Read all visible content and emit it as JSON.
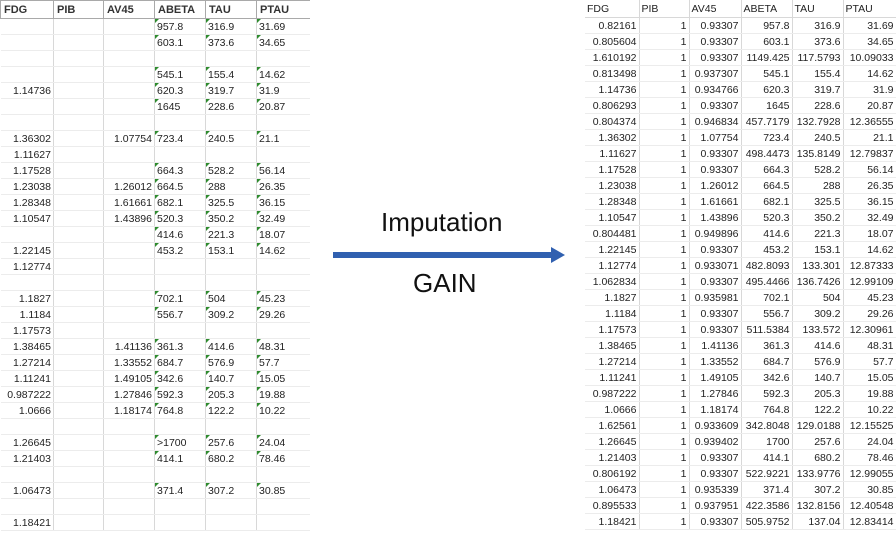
{
  "headers": [
    "FDG",
    "PIB",
    "AV45",
    "ABETA",
    "TAU",
    "PTAU"
  ],
  "left_rows": [
    [
      "",
      "",
      "",
      "957.8",
      "316.9",
      "31.69"
    ],
    [
      "",
      "",
      "",
      "603.1",
      "373.6",
      "34.65"
    ],
    [
      "",
      "",
      "",
      "",
      "",
      ""
    ],
    [
      "",
      "",
      "",
      "545.1",
      "155.4",
      "14.62"
    ],
    [
      "1.14736",
      "",
      "",
      "620.3",
      "319.7",
      "31.9"
    ],
    [
      "",
      "",
      "",
      "1645",
      "228.6",
      "20.87"
    ],
    [
      "",
      "",
      "",
      "",
      "",
      ""
    ],
    [
      "1.36302",
      "",
      "1.07754",
      "723.4",
      "240.5",
      "21.1"
    ],
    [
      "1.11627",
      "",
      "",
      "",
      "",
      ""
    ],
    [
      "1.17528",
      "",
      "",
      "664.3",
      "528.2",
      "56.14"
    ],
    [
      "1.23038",
      "",
      "1.26012",
      "664.5",
      "288",
      "26.35"
    ],
    [
      "1.28348",
      "",
      "1.61661",
      "682.1",
      "325.5",
      "36.15"
    ],
    [
      "1.10547",
      "",
      "1.43896",
      "520.3",
      "350.2",
      "32.49"
    ],
    [
      "",
      "",
      "",
      "414.6",
      "221.3",
      "18.07"
    ],
    [
      "1.22145",
      "",
      "",
      "453.2",
      "153.1",
      "14.62"
    ],
    [
      "1.12774",
      "",
      "",
      "",
      "",
      ""
    ],
    [
      "",
      "",
      "",
      "",
      "",
      ""
    ],
    [
      "1.1827",
      "",
      "",
      "702.1",
      "504",
      "45.23"
    ],
    [
      "1.1184",
      "",
      "",
      "556.7",
      "309.2",
      "29.26"
    ],
    [
      "1.17573",
      "",
      "",
      "",
      "",
      ""
    ],
    [
      "1.38465",
      "",
      "1.41136",
      "361.3",
      "414.6",
      "48.31"
    ],
    [
      "1.27214",
      "",
      "1.33552",
      "684.7",
      "576.9",
      "57.7"
    ],
    [
      "1.11241",
      "",
      "1.49105",
      "342.6",
      "140.7",
      "15.05"
    ],
    [
      "0.987222",
      "",
      "1.27846",
      "592.3",
      "205.3",
      "19.88"
    ],
    [
      "1.0666",
      "",
      "1.18174",
      "764.8",
      "122.2",
      "10.22"
    ],
    [
      "",
      "",
      "",
      "",
      "",
      ""
    ],
    [
      "1.26645",
      "",
      "",
      ">1700",
      "257.6",
      "24.04"
    ],
    [
      "1.21403",
      "",
      "",
      "414.1",
      "680.2",
      "78.46"
    ],
    [
      "",
      "",
      "",
      "",
      "",
      ""
    ],
    [
      "1.06473",
      "",
      "",
      "371.4",
      "307.2",
      "30.85"
    ],
    [
      "",
      "",
      "",
      "",
      "",
      ""
    ],
    [
      "1.18421",
      "",
      "",
      "",
      "",
      ""
    ]
  ],
  "right_rows": [
    [
      "0.82161",
      "1",
      "0.93307",
      "957.8",
      "316.9",
      "31.69"
    ],
    [
      "0.805604",
      "1",
      "0.93307",
      "603.1",
      "373.6",
      "34.65"
    ],
    [
      "1.610192",
      "1",
      "0.93307",
      "1149.425",
      "117.5793",
      "10.09033"
    ],
    [
      "0.813498",
      "1",
      "0.937307",
      "545.1",
      "155.4",
      "14.62"
    ],
    [
      "1.14736",
      "1",
      "0.934766",
      "620.3",
      "319.7",
      "31.9"
    ],
    [
      "0.806293",
      "1",
      "0.93307",
      "1645",
      "228.6",
      "20.87"
    ],
    [
      "0.804374",
      "1",
      "0.946834",
      "457.7179",
      "132.7928",
      "12.36555"
    ],
    [
      "1.36302",
      "1",
      "1.07754",
      "723.4",
      "240.5",
      "21.1"
    ],
    [
      "1.11627",
      "1",
      "0.93307",
      "498.4473",
      "135.8149",
      "12.79837"
    ],
    [
      "1.17528",
      "1",
      "0.93307",
      "664.3",
      "528.2",
      "56.14"
    ],
    [
      "1.23038",
      "1",
      "1.26012",
      "664.5",
      "288",
      "26.35"
    ],
    [
      "1.28348",
      "1",
      "1.61661",
      "682.1",
      "325.5",
      "36.15"
    ],
    [
      "1.10547",
      "1",
      "1.43896",
      "520.3",
      "350.2",
      "32.49"
    ],
    [
      "0.804481",
      "1",
      "0.949896",
      "414.6",
      "221.3",
      "18.07"
    ],
    [
      "1.22145",
      "1",
      "0.93307",
      "453.2",
      "153.1",
      "14.62"
    ],
    [
      "1.12774",
      "1",
      "0.933071",
      "482.8093",
      "133.301",
      "12.87333"
    ],
    [
      "1.062834",
      "1",
      "0.93307",
      "495.4466",
      "136.7426",
      "12.99109"
    ],
    [
      "1.1827",
      "1",
      "0.935981",
      "702.1",
      "504",
      "45.23"
    ],
    [
      "1.1184",
      "1",
      "0.93307",
      "556.7",
      "309.2",
      "29.26"
    ],
    [
      "1.17573",
      "1",
      "0.93307",
      "511.5384",
      "133.572",
      "12.30961"
    ],
    [
      "1.38465",
      "1",
      "1.41136",
      "361.3",
      "414.6",
      "48.31"
    ],
    [
      "1.27214",
      "1",
      "1.33552",
      "684.7",
      "576.9",
      "57.7"
    ],
    [
      "1.11241",
      "1",
      "1.49105",
      "342.6",
      "140.7",
      "15.05"
    ],
    [
      "0.987222",
      "1",
      "1.27846",
      "592.3",
      "205.3",
      "19.88"
    ],
    [
      "1.0666",
      "1",
      "1.18174",
      "764.8",
      "122.2",
      "10.22"
    ],
    [
      "1.62561",
      "1",
      "0.933609",
      "342.8048",
      "129.0188",
      "12.15525"
    ],
    [
      "1.26645",
      "1",
      "0.939402",
      "1700",
      "257.6",
      "24.04"
    ],
    [
      "1.21403",
      "1",
      "0.93307",
      "414.1",
      "680.2",
      "78.46"
    ],
    [
      "0.806192",
      "1",
      "0.93307",
      "522.9221",
      "133.9776",
      "12.99055"
    ],
    [
      "1.06473",
      "1",
      "0.935339",
      "371.4",
      "307.2",
      "30.85"
    ],
    [
      "0.895533",
      "1",
      "0.937951",
      "422.3586",
      "132.8156",
      "12.40548"
    ],
    [
      "1.18421",
      "1",
      "0.93307",
      "505.9752",
      "137.04",
      "12.83414"
    ]
  ],
  "arrow": {
    "top_label": "Imputation",
    "bottom_label": "GAIN",
    "color": "#3060b0"
  },
  "colors": {
    "gridline": "#d8d8d8",
    "comment_marker": "#2e8b2e"
  }
}
